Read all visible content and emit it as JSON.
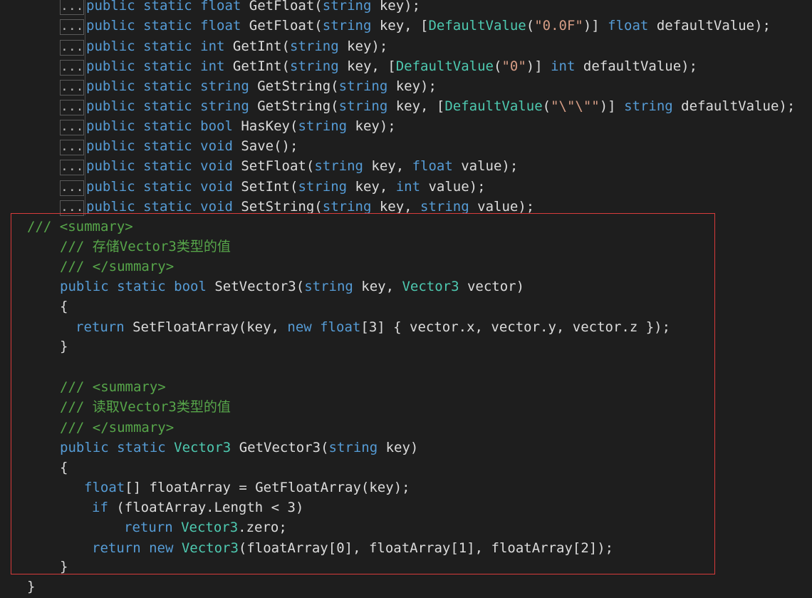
{
  "collapsed_marker": "...",
  "declarations": [
    {
      "pre": "public static ",
      "type": "float",
      "name": " GetFloat(",
      "args": [
        [
          "string",
          " key);"
        ]
      ]
    },
    {
      "pre": "public static ",
      "type": "float",
      "name": " GetFloat(",
      "args": [
        [
          "string",
          " key, ["
        ],
        [
          "DefaultValue",
          "(\"0.0F\")] "
        ],
        [
          "float",
          " defaultValue);"
        ]
      ]
    },
    {
      "pre": "public static ",
      "type": "int",
      "name": " GetInt(",
      "args": [
        [
          "string",
          " key);"
        ]
      ]
    },
    {
      "pre": "public static ",
      "type": "int",
      "name": " GetInt(",
      "args": [
        [
          "string",
          " key, ["
        ],
        [
          "DefaultValue",
          "(\"0\")] "
        ],
        [
          "int",
          " defaultValue);"
        ]
      ]
    },
    {
      "pre": "public static ",
      "type": "string",
      "name": " GetString(",
      "args": [
        [
          "string",
          " key);"
        ]
      ]
    },
    {
      "pre": "public static ",
      "type": "string",
      "name": " GetString(",
      "args": [
        [
          "string",
          " key, ["
        ],
        [
          "DefaultValue",
          "(\"\\\"\\\"\")] "
        ],
        [
          "string",
          " defaultValue);"
        ]
      ]
    },
    {
      "pre": "public static ",
      "type": "bool",
      "name": " HasKey(",
      "args": [
        [
          "string",
          " key);"
        ]
      ]
    },
    {
      "pre": "public static ",
      "type": "void",
      "name": " Save();",
      "args": []
    },
    {
      "pre": "public static ",
      "type": "void",
      "name": " SetFloat(",
      "args": [
        [
          "string",
          " key, "
        ],
        [
          "float",
          " value);"
        ]
      ]
    },
    {
      "pre": "public static ",
      "type": "void",
      "name": " SetInt(",
      "args": [
        [
          "string",
          " key, "
        ],
        [
          "int",
          " value);"
        ]
      ]
    },
    {
      "pre": "public static ",
      "type": "void",
      "name": " SetString(",
      "args": [
        [
          "string",
          " key, "
        ],
        [
          "string",
          " value);"
        ]
      ]
    }
  ],
  "code": {
    "l1": "/// <summary>",
    "l2": "/// 存储Vector3类型的值",
    "l3": "/// </summary>",
    "l4_a": "public static bool",
    "l4_b": " SetVector3(",
    "l4_c": "string",
    "l4_d": " key, ",
    "l4_e": "Vector3",
    "l4_f": " vector)",
    "l5": "{",
    "l6_a": "return",
    "l6_b": " SetFloatArray(key, ",
    "l6_c": "new float",
    "l6_d": "[3] { vector.x, vector.y, vector.z });",
    "l7": "}",
    "l8": "/// <summary>",
    "l9": "/// 读取Vector3类型的值",
    "l10": "/// </summary>",
    "l11_a": "public static",
    "l11_b": "Vector3",
    "l11_c": " GetVector3(",
    "l11_d": "string",
    "l11_e": " key)",
    "l12": "{",
    "l13_a": "float",
    "l13_b": "[] floatArray = GetFloatArray(key);",
    "l14_a": "if",
    "l14_b": " (floatArray.Length < 3)",
    "l15_a": "return",
    "l15_b": "Vector3",
    "l15_c": ".zero;",
    "l16_a": "return new",
    "l16_b": "Vector3",
    "l16_c": "(floatArray[0], floatArray[1], floatArray[2]);",
    "l17": "}",
    "l18": "}"
  },
  "colors": {
    "keyword": "#569cd6",
    "type": "#4ec9b0",
    "string": "#d69d85",
    "comment": "#57a64a",
    "highlight_border": "#d83b3b"
  }
}
